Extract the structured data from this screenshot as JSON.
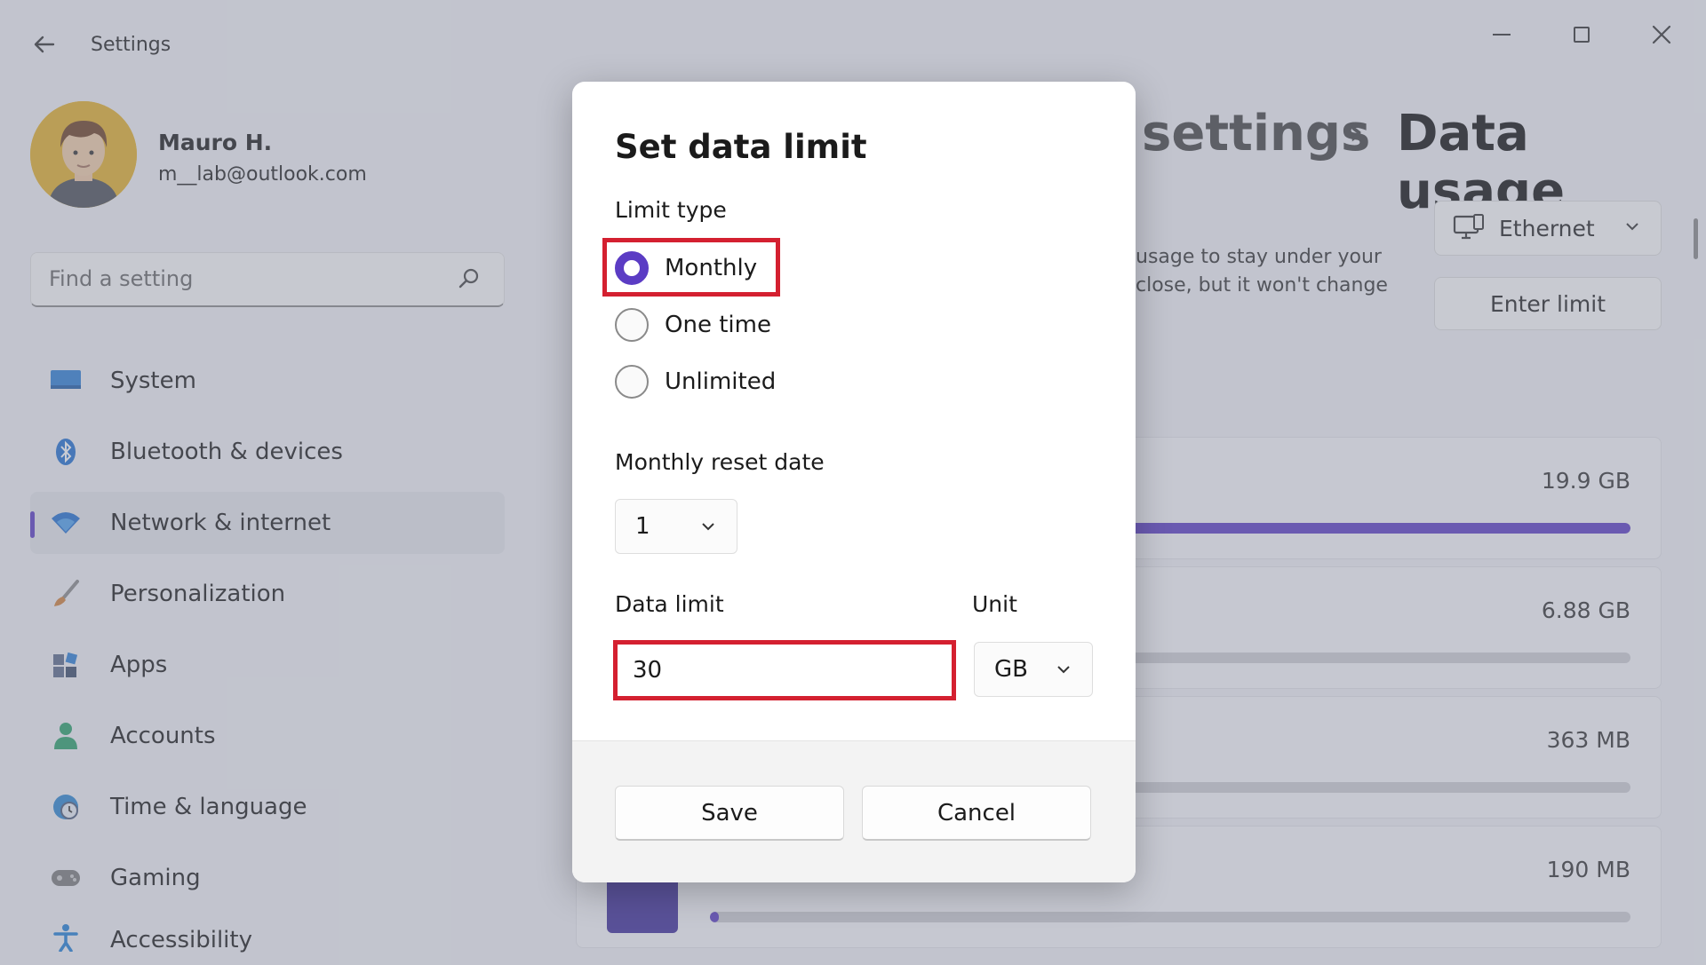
{
  "window": {
    "title": "Settings",
    "back_icon": "arrow-left-icon",
    "controls": [
      "minimize-icon",
      "maximize-icon",
      "close-icon"
    ]
  },
  "user": {
    "name": "Mauro H.",
    "email": "m__lab@outlook.com"
  },
  "search": {
    "placeholder": "Find a setting"
  },
  "sidebar": {
    "items": [
      {
        "label": "System",
        "icon": "monitor-icon",
        "color": "#2b7fd6"
      },
      {
        "label": "Bluetooth & devices",
        "icon": "bluetooth-icon",
        "color": "#1f6fd0"
      },
      {
        "label": "Network & internet",
        "icon": "wifi-icon",
        "color": "#1f6fd0"
      },
      {
        "label": "Personalization",
        "icon": "brush-icon",
        "color": "#d0803a"
      },
      {
        "label": "Apps",
        "icon": "apps-icon",
        "color": "#5a6a8a"
      },
      {
        "label": "Accounts",
        "icon": "person-icon",
        "color": "#2aa06a"
      },
      {
        "label": "Time & language",
        "icon": "globe-clock-icon",
        "color": "#2b86d0"
      },
      {
        "label": "Gaming",
        "icon": "gamepad-icon",
        "color": "#6a6a6a"
      },
      {
        "label": "Accessibility",
        "icon": "accessibility-icon",
        "color": "#1f7fd6"
      }
    ],
    "active_index": 2
  },
  "breadcrumb": {
    "previous": "settings",
    "separator": "›",
    "current": "Data usage"
  },
  "network_select": {
    "value": "Ethernet",
    "icon": "pc-icon"
  },
  "enter_limit_label": "Enter limit",
  "description": "usage to stay under your close, but it won't change",
  "usage_rows": [
    {
      "amount": "19.9 GB",
      "fill_percent": 100
    },
    {
      "amount": "6.88 GB",
      "fill_percent": 0
    },
    {
      "amount": "363 MB",
      "fill_percent": 0
    },
    {
      "amount": "190 MB",
      "fill_percent": 1
    }
  ],
  "dialog": {
    "title": "Set data limit",
    "limit_type_label": "Limit type",
    "options": [
      "Monthly",
      "One time",
      "Unlimited"
    ],
    "selected_option": "Monthly",
    "reset_date_label": "Monthly reset date",
    "reset_date_value": "1",
    "data_limit_label": "Data limit",
    "data_limit_value": "30",
    "unit_label": "Unit",
    "unit_value": "GB",
    "save_label": "Save",
    "cancel_label": "Cancel"
  },
  "colors": {
    "accent": "#5b3cc4",
    "highlight_box": "#d42030"
  }
}
